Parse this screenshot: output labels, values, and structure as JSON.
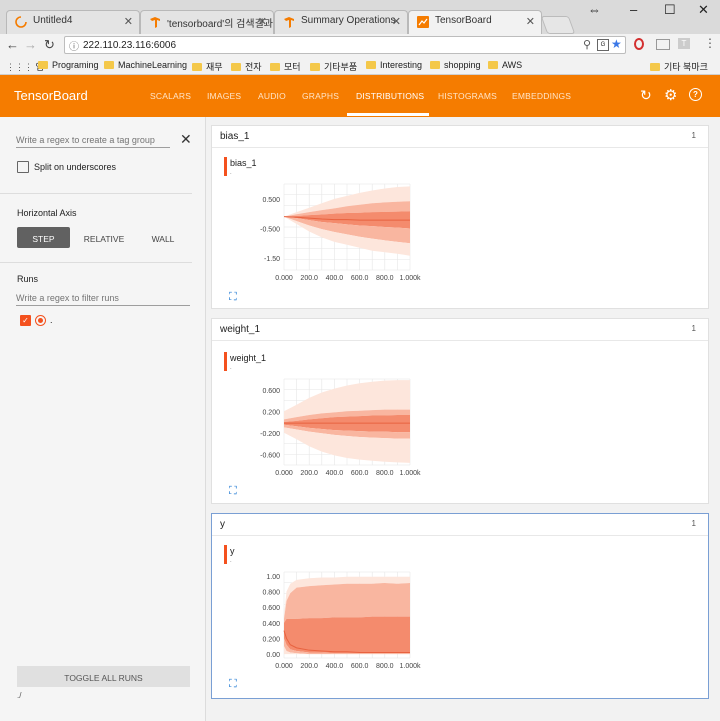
{
  "browser": {
    "tabs": [
      {
        "title": "Untitled4"
      },
      {
        "title": "'tensorboard'의 검색결과"
      },
      {
        "title": "Summary Operations"
      },
      {
        "title": "TensorBoard"
      }
    ],
    "url": "222.110.23.116:6006",
    "bookmarks": [
      "앱",
      "Programing",
      "MachineLearning",
      "재무",
      "전자",
      "모터",
      "기타부품",
      "Interesting",
      "shopping",
      "AWS",
      "기타 북마크"
    ]
  },
  "tensorboard": {
    "title": "TensorBoard",
    "nav": [
      "SCALARS",
      "IMAGES",
      "AUDIO",
      "GRAPHS",
      "DISTRIBUTIONS",
      "HISTOGRAMS",
      "EMBEDDINGS"
    ],
    "active_nav": "DISTRIBUTIONS",
    "accent": "#f57c00"
  },
  "sidebar": {
    "tag_group_placeholder": "Write a regex to create a tag group",
    "split_label": "Split on underscores",
    "axis_title": "Horizontal Axis",
    "axis_options": [
      "STEP",
      "RELATIVE",
      "WALL"
    ],
    "axis_selected": "STEP",
    "runs_title": "Runs",
    "runs_filter_placeholder": "Write a regex to filter runs",
    "run_name": ".",
    "toggle_label": "TOGGLE ALL RUNS",
    "logdir": "./"
  },
  "cards": [
    {
      "name": "bias_1",
      "count": "1",
      "tag": "bias_1",
      "run": "."
    },
    {
      "name": "weight_1",
      "count": "1",
      "tag": "weight_1",
      "run": "."
    },
    {
      "name": "y",
      "count": "1",
      "tag": "y",
      "run": "."
    }
  ],
  "chart_data": [
    {
      "type": "area",
      "title": "bias_1",
      "x_ticks": [
        "0.000",
        "200.0",
        "400.0",
        "600.0",
        "800.0",
        "1.000k"
      ],
      "y_ticks": [
        "0.500",
        "-0.500",
        "-1.50"
      ],
      "xlim": [
        0,
        1000
      ],
      "ylim": [
        -1.9,
        1.0
      ],
      "x": [
        0,
        100,
        200,
        300,
        400,
        500,
        600,
        700,
        800,
        900,
        1000
      ],
      "series": [
        {
          "values": [
            -0.1,
            0.05,
            0.2,
            0.35,
            0.5,
            0.6,
            0.7,
            0.78,
            0.85,
            0.9,
            0.92
          ]
        },
        {
          "values": [
            -0.1,
            -0.02,
            0.05,
            0.12,
            0.18,
            0.25,
            0.3,
            0.35,
            0.38,
            0.4,
            0.42
          ]
        },
        {
          "values": [
            -0.1,
            -0.08,
            -0.05,
            -0.03,
            0,
            0.02,
            0.03,
            0.05,
            0.06,
            0.07,
            0.08
          ]
        },
        {
          "values": [
            -0.1,
            -0.12,
            -0.15,
            -0.18,
            -0.2,
            -0.2,
            -0.22,
            -0.22,
            -0.22,
            -0.22,
            -0.22
          ]
        },
        {
          "values": [
            -0.1,
            -0.15,
            -0.22,
            -0.28,
            -0.32,
            -0.36,
            -0.4,
            -0.42,
            -0.45,
            -0.47,
            -0.5
          ]
        },
        {
          "values": [
            -0.1,
            -0.25,
            -0.4,
            -0.52,
            -0.62,
            -0.7,
            -0.78,
            -0.84,
            -0.9,
            -0.95,
            -1.0
          ]
        },
        {
          "values": [
            -0.1,
            -0.35,
            -0.6,
            -0.8,
            -0.95,
            -1.05,
            -1.15,
            -1.25,
            -1.3,
            -1.35,
            -1.42
          ]
        }
      ]
    },
    {
      "type": "area",
      "title": "weight_1",
      "x_ticks": [
        "0.000",
        "200.0",
        "400.0",
        "600.0",
        "800.0",
        "1.000k"
      ],
      "y_ticks": [
        "0.600",
        "0.200",
        "-0.200",
        "-0.600"
      ],
      "xlim": [
        0,
        1000
      ],
      "ylim": [
        -0.8,
        0.8
      ],
      "x": [
        0,
        100,
        200,
        300,
        400,
        500,
        600,
        700,
        800,
        900,
        1000
      ],
      "series": [
        {
          "values": [
            0.2,
            0.32,
            0.45,
            0.55,
            0.62,
            0.68,
            0.72,
            0.75,
            0.77,
            0.78,
            0.78
          ]
        },
        {
          "values": [
            0.05,
            0.09,
            0.13,
            0.16,
            0.18,
            0.2,
            0.21,
            0.22,
            0.23,
            0.23,
            0.23
          ]
        },
        {
          "values": [
            0,
            0.02,
            0.05,
            0.07,
            0.09,
            0.1,
            0.11,
            0.12,
            0.12,
            0.13,
            0.13
          ]
        },
        {
          "values": [
            -0.02,
            -0.02,
            -0.02,
            -0.02,
            -0.02,
            -0.02,
            -0.02,
            -0.02,
            -0.02,
            -0.02,
            -0.02
          ]
        },
        {
          "values": [
            -0.05,
            -0.08,
            -0.11,
            -0.13,
            -0.15,
            -0.16,
            -0.17,
            -0.18,
            -0.18,
            -0.19,
            -0.19
          ]
        },
        {
          "values": [
            -0.1,
            -0.14,
            -0.18,
            -0.21,
            -0.24,
            -0.26,
            -0.28,
            -0.29,
            -0.3,
            -0.31,
            -0.31
          ]
        },
        {
          "values": [
            -0.2,
            -0.32,
            -0.45,
            -0.55,
            -0.62,
            -0.67,
            -0.7,
            -0.72,
            -0.74,
            -0.75,
            -0.76
          ]
        }
      ]
    },
    {
      "type": "area",
      "title": "y",
      "x_ticks": [
        "0.000",
        "200.0",
        "400.0",
        "600.0",
        "800.0",
        "1.000k"
      ],
      "y_ticks": [
        "1.00",
        "0.800",
        "0.600",
        "0.400",
        "0.200",
        "0.00"
      ],
      "xlim": [
        0,
        1000
      ],
      "ylim": [
        -0.05,
        1.05
      ],
      "x": [
        0,
        20,
        50,
        100,
        200,
        300,
        400,
        500,
        600,
        700,
        800,
        900,
        1000
      ],
      "series": [
        {
          "values": [
            0.5,
            0.8,
            0.9,
            0.95,
            0.97,
            0.98,
            0.98,
            0.99,
            0.99,
            0.99,
            0.99,
            0.99,
            0.99
          ]
        },
        {
          "values": [
            0.45,
            0.68,
            0.78,
            0.85,
            0.87,
            0.88,
            0.89,
            0.9,
            0.9,
            0.9,
            0.91,
            0.9,
            0.91
          ]
        },
        {
          "values": [
            0.4,
            0.45,
            0.45,
            0.45,
            0.46,
            0.46,
            0.47,
            0.47,
            0.47,
            0.48,
            0.48,
            0.48,
            0.48
          ]
        },
        {
          "values": [
            0.3,
            0.2,
            0.12,
            0.08,
            0.05,
            0.04,
            0.03,
            0.03,
            0.02,
            0.02,
            0.02,
            0.02,
            0.02
          ]
        },
        {
          "values": [
            0.2,
            0.12,
            0.06,
            0.04,
            0.02,
            0.02,
            0.01,
            0.01,
            0.01,
            0.01,
            0.01,
            0.01,
            0.01
          ]
        },
        {
          "values": [
            0.1,
            0.04,
            0.02,
            0.01,
            0,
            0,
            0,
            0,
            0,
            0,
            0,
            0,
            0
          ]
        },
        {
          "values": [
            0,
            0,
            0,
            0,
            0,
            0,
            0,
            0,
            0,
            0,
            0,
            0,
            0
          ]
        }
      ]
    }
  ]
}
